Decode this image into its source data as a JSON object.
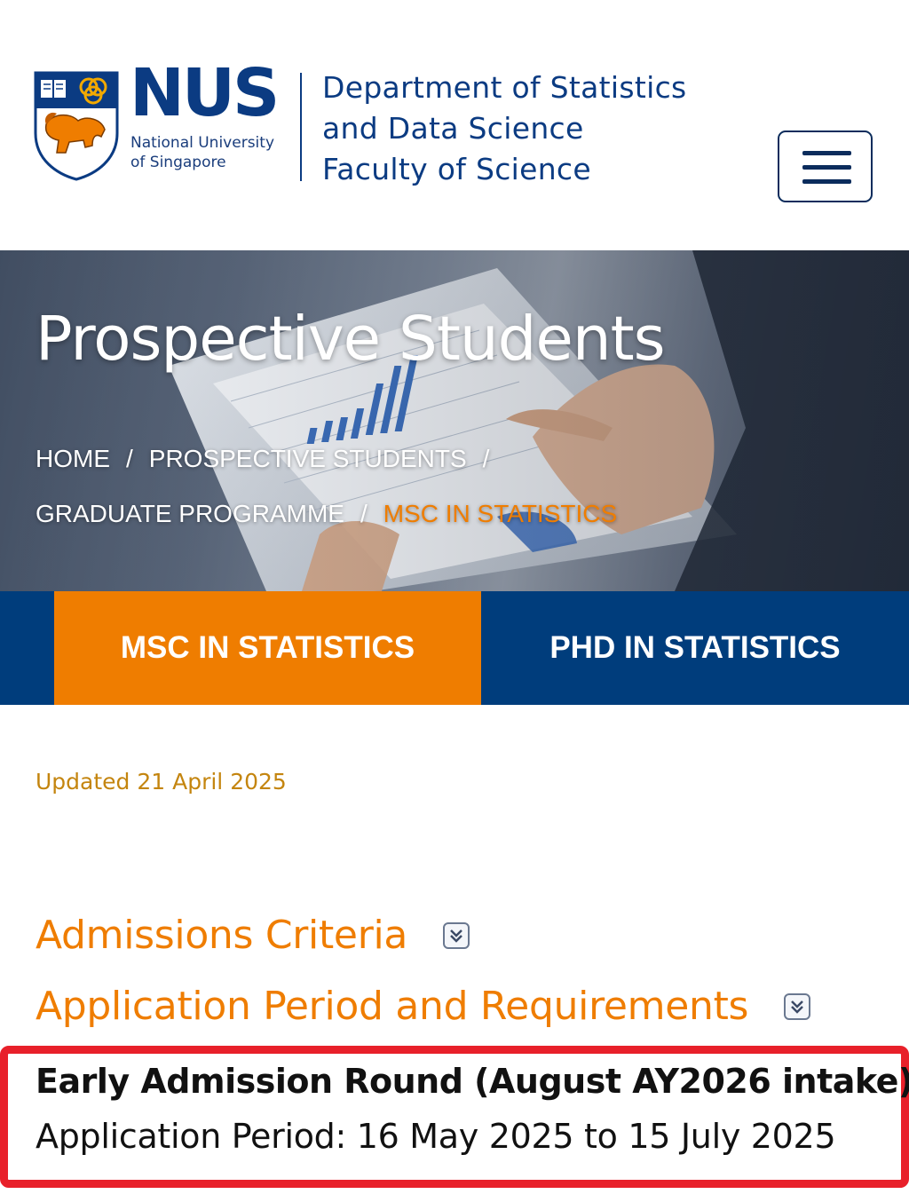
{
  "header": {
    "logo_word": "NUS",
    "logo_sub_line1": "National University",
    "logo_sub_line2": "of Singapore",
    "dept_line1": "Department of Statistics",
    "dept_line2": "and Data Science",
    "dept_line3": "Faculty of Science",
    "menu_icon": "hamburger-menu-icon"
  },
  "hero": {
    "title": "Prospective Students",
    "breadcrumb": {
      "home": "HOME",
      "prospective": "PROSPECTIVE STUDENTS",
      "graduate": "GRADUATE PROGRAMME",
      "current": "MSC IN STATISTICS",
      "separator": "/"
    }
  },
  "tabs": {
    "msc": "MSC IN STATISTICS",
    "phd": "PHD IN STATISTICS"
  },
  "content": {
    "updated": "Updated 21 April 2025",
    "accordion": [
      {
        "title": "Admissions Criteria",
        "icon": "double-chevron-down-icon"
      },
      {
        "title": "Application Period and Requirements",
        "icon": "double-chevron-down-icon"
      }
    ],
    "early_round_title": "Early Admission Round (August AY2026 intake)",
    "application_period": "Application Period: 16 May 2025 to 15 July 2025"
  },
  "colors": {
    "nus_blue": "#003d7c",
    "nus_orange": "#ef7d00",
    "highlight_red": "#e8202a",
    "updated_text": "#c4850f"
  }
}
